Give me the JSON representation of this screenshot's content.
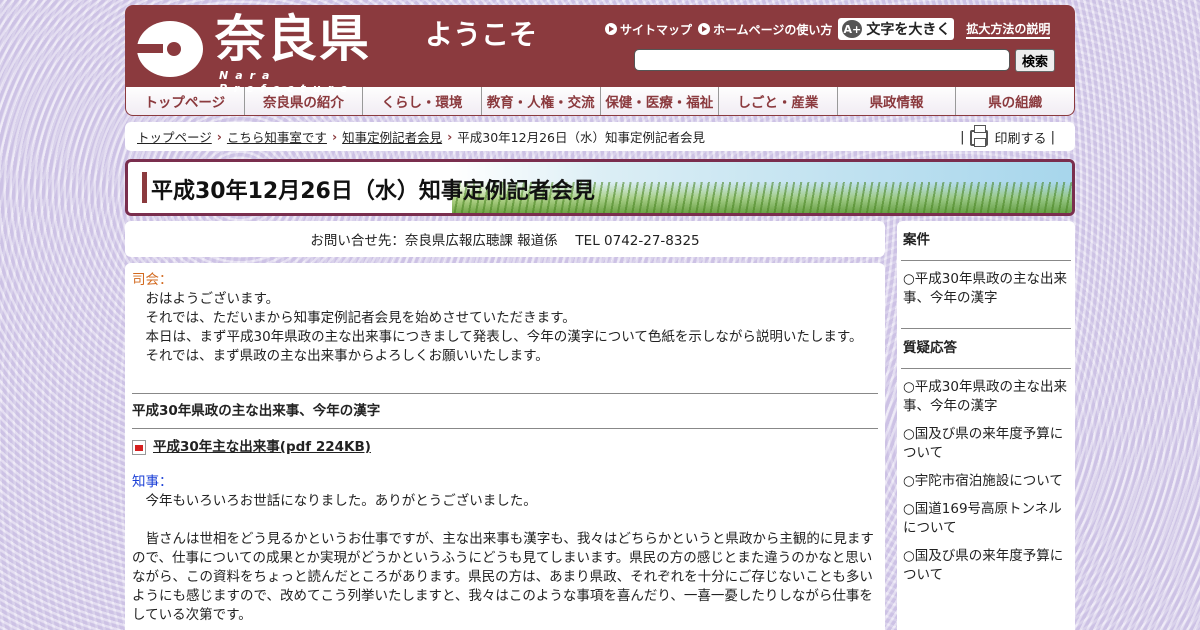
{
  "header": {
    "logo_title": "奈良県",
    "logo_sub": "Nara Prefecture",
    "welcome": "ようこそ",
    "links": [
      {
        "label": "サイトマップ"
      },
      {
        "label": "ホームページの使い方"
      }
    ],
    "bigtext_label": "文字を大きく",
    "bigtext_icon": "A+",
    "explain_label": "拡大方法の説明",
    "search_value": "",
    "search_button": "検索"
  },
  "nav": [
    "トップページ",
    "奈良県の紹介",
    "くらし・環境",
    "教育・人権・交流",
    "保健・医療・福祉",
    "しごと・産業",
    "県政情報",
    "県の組織"
  ],
  "breadcrumb": {
    "items": [
      "トップページ",
      "こちら知事室です",
      "知事定例記者会見"
    ],
    "current": "平成30年12月26日（水）知事定例記者会見",
    "print_label": "印刷する"
  },
  "title": "平成30年12月26日（水）知事定例記者会見",
  "contact": "お問い合せ先：奈良県広報広聴課 報道係　 TEL 0742-27-8325",
  "main": {
    "speaker1": "司会：",
    "para1": [
      "おはようございます。",
      "それでは、ただいまから知事定例記者会見を始めさせていただきます。",
      "本日は、まず平成30年県政の主な出来事につきまして発表し、今年の漢字について色紙を示しながら説明いたします。",
      "それでは、まず県政の主な出来事からよろしくお願いいたします。"
    ],
    "section_title": "平成30年県政の主な出来事、今年の漢字",
    "pdf_label": "平成30年主な出来事(pdf 224KB)",
    "speaker2": "知事：",
    "para2": [
      "今年もいろいろお世話になりました。ありがとうございました。",
      "皆さんは世相をどう見るかというお仕事ですが、主な出来事も漢字も、我々はどちらかというと県政から主観的に見ますので、仕事についての成果とか実現がどうかというふうにどうも見てしまいます。県民の方の感じとまた違うのかなと思いながら、この資料をちょっと読んだところがあります。県民の方は、あまり県政、それぞれを十分にご存じないことも多いようにも感じますので、改めてこう列挙いたしますと、我々はこのような事項を喜んだり、一喜一憂したりしながら仕事をしている次第です。"
    ]
  },
  "side": {
    "head1": "案件",
    "items1": [
      "○平成30年県政の主な出来事、今年の漢字"
    ],
    "head2": "質疑応答",
    "items2": [
      "○平成30年県政の主な出来事、今年の漢字",
      "○国及び県の来年度予算について",
      "○宇陀市宿泊施設について",
      "○国道169号高原トンネルについて",
      "○国及び県の来年度予算について"
    ]
  }
}
